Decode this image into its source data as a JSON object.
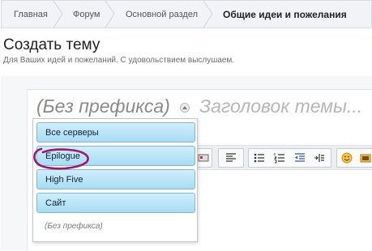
{
  "breadcrumb": {
    "items": [
      "Главная",
      "Форум",
      "Основной раздел",
      "Общие идеи и пожелания"
    ]
  },
  "page": {
    "title": "Создать тему",
    "subtitle": "Для Ваших идей и пожеланий. С удовольствием выслушаем."
  },
  "editor": {
    "prefix_label": "(Без префикса)",
    "title_placeholder": "Заголовок темы..."
  },
  "prefix_menu": {
    "options": [
      "Все серверы",
      "Epilogue",
      "High Five",
      "Сайт"
    ],
    "none_option": "(Без префикса)",
    "highlight_color": "#a0166e"
  },
  "colors": {
    "option_bg": "#b7e3f7",
    "option_border": "#7fb7d6",
    "breadcrumb_bg": "#f1f3f6"
  },
  "toolbar": {
    "icons": [
      "image-icon",
      "align-left-icon",
      "bullet-list-icon",
      "numbered-list-icon",
      "outdent-icon",
      "indent-icon",
      "smiley-icon",
      "media-icon"
    ]
  }
}
